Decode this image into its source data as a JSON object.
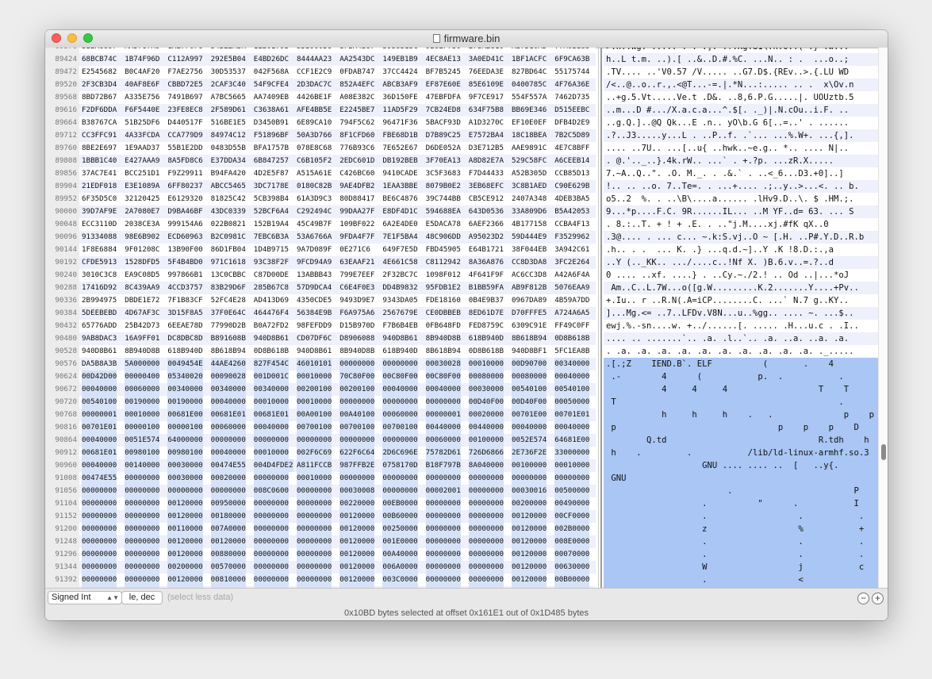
{
  "window": {
    "title": "firmware.bin"
  },
  "hex_rows": [
    {
      "offset": "89376",
      "groups": [
        "3EBA6897",
        "AA5767A9",
        "1AE7F0F6",
        "54BE2A3A",
        "1EB0179B",
        "5DB900D6",
        "3FBA4B67",
        "5938315C",
        "9E6EF730",
        "E73A2810",
        "AE7D10AD",
        "77A0BE83"
      ]
    },
    {
      "offset": "89424",
      "groups": [
        "68BCB74C",
        "1B74F96D",
        "C112A997",
        "292E5B04",
        "E4BD26DC",
        "8444AA23",
        "AA2543DC",
        "149EB1B9",
        "4EC8AE13",
        "3A0ED41C",
        "1BF1ACFC",
        "6F9CA63B"
      ]
    },
    {
      "offset": "89472",
      "groups": [
        "E2545682",
        "B0C4AF20",
        "F7AE2756",
        "30D53537",
        "042F568A",
        "CCF1E2C9",
        "0FDAB747",
        "37CC4424",
        "BF7B5245",
        "76EEDA3E",
        "827BD64C",
        "55175744"
      ]
    },
    {
      "offset": "89520",
      "groups": [
        "2F3CB3D4",
        "40AF8E6F",
        "CBBD72E5",
        "2CAF3C40",
        "54F9CFE4",
        "2D3DAC7C",
        "852A4EFC",
        "ABCB3AF9",
        "EF87E60E",
        "85E6109E",
        "0400785C",
        "4F76A36E"
      ]
    },
    {
      "offset": "89568",
      "groups": [
        "8BD72B67",
        "A335E756",
        "7491B697",
        "A7BC5665",
        "AA7409EB",
        "4426BE1F",
        "A08E382C",
        "36D150FE",
        "47EBFDFA",
        "9F7CE917",
        "554F557A",
        "7462D735"
      ]
    },
    {
      "offset": "89616",
      "groups": [
        "F2DF6DDA",
        "F6F5440E",
        "23FE8EC8",
        "2F589D61",
        "C3638A61",
        "AFE4BB5E",
        "E2245BE7",
        "11AD5F29",
        "7CB24ED8",
        "634F75B8",
        "BB69E346",
        "D515EEBC"
      ]
    },
    {
      "offset": "89664",
      "groups": [
        "B38767CA",
        "51B25DF6",
        "D440517F",
        "516BE1E5",
        "D3450B91",
        "6E89CA10",
        "794F5C62",
        "96471F36",
        "5BACF93D",
        "A1D3270C",
        "EF10E0EF",
        "DFB4D2E9"
      ]
    },
    {
      "offset": "89712",
      "groups": [
        "CC3FFC91",
        "4A33FCDA",
        "CCA779D9",
        "84974C12",
        "F51896BF",
        "50A3D766",
        "8F1CFD60",
        "FBE68D1B",
        "D7B89C25",
        "E7572BA4",
        "18C18BEA",
        "7B2C5D89"
      ]
    },
    {
      "offset": "89760",
      "groups": [
        "8BE2E697",
        "1E9AAD37",
        "55B1E2DD",
        "0483D55B",
        "BFA1757B",
        "078E8C68",
        "776B93C6",
        "7E652E67",
        "D6DE052A",
        "D3E712B5",
        "AAE9891C",
        "4E7C8BFF"
      ]
    },
    {
      "offset": "89808",
      "groups": [
        "1BBB1C40",
        "E427AAA9",
        "8A5FD8C6",
        "E37DDA34",
        "6B847257",
        "C6B105F2",
        "2EDC601D",
        "DB192BEB",
        "3F70EA13",
        "A8D82E7A",
        "529C58FC",
        "A6CEEB14"
      ]
    },
    {
      "offset": "89856",
      "groups": [
        "37AC7E41",
        "BCC251D1",
        "F9Z29911",
        "B94FA420",
        "4D2E5F87",
        "A515A61E",
        "C426BC60",
        "9410CADE",
        "3C5F3683",
        "F7D44433",
        "A52B305D",
        "CCB85D13"
      ]
    },
    {
      "offset": "89904",
      "groups": [
        "21EDF018",
        "E3E1089A",
        "6FF80237",
        "ABCC5465",
        "3DC7178E",
        "0180C82B",
        "9AE4DFB2",
        "1EAA3BBE",
        "8079B0E2",
        "3EB68EFC",
        "3C8B1AED",
        "C90E629B"
      ]
    },
    {
      "offset": "89952",
      "groups": [
        "6F35D5C0",
        "32120425",
        "E6129320",
        "81825C42",
        "5CB398B4",
        "61A3D9C3",
        "80D88417",
        "BE6C4876",
        "39C744BB",
        "CB5CE912",
        "2407A348",
        "4DEB3BA5"
      ]
    },
    {
      "offset": "90000",
      "groups": [
        "39D7AF9E",
        "2A7080E7",
        "D9BA46BF",
        "43DC0339",
        "52BCF6A4",
        "C292494C",
        "99DAA27F",
        "E8DF4D1C",
        "594688EA",
        "643D0536",
        "33A809D6",
        "B5A42053"
      ]
    },
    {
      "offset": "90048",
      "groups": [
        "ECC3110D",
        "2038CE3A",
        "999154A6",
        "022B0821",
        "152B19A4",
        "45C49B7F",
        "109BF022",
        "6A2E4DE0",
        "E5DACA78",
        "6AEF2366",
        "4B177158",
        "CCBA4F13"
      ]
    },
    {
      "offset": "90096",
      "groups": [
        "91334088",
        "98E6B902",
        "ECD60963",
        "B2C0981C",
        "7EBC6B3A",
        "53A6766A",
        "9FDA4F7F",
        "7E1F5BA4",
        "48C906DD",
        "A95023D2",
        "59D444E9",
        "F3529962"
      ]
    },
    {
      "offset": "90144",
      "groups": [
        "1F8E6884",
        "9F01208C",
        "13B90F00",
        "86D1FB04",
        "1D4B9715",
        "9A7D089F",
        "0E271C6",
        "649F7E5D",
        "FBD45905",
        "E64B1721",
        "38F044EB",
        "3A942C61"
      ]
    },
    {
      "offset": "90192",
      "groups": [
        "CFDE5913",
        "1528DFD5",
        "5F4B4BD0",
        "971C1618",
        "93C38F2F",
        "9FCD94A9",
        "63EAAF21",
        "4E661C58",
        "C8112942",
        "8A36A876",
        "CC8D3DA8",
        "3FC2E264"
      ]
    },
    {
      "offset": "90240",
      "groups": [
        "3010C3C8",
        "EA9C08D5",
        "997866B1",
        "13C0CBBC",
        "C87D00DE",
        "13ABBB43",
        "799E7EEF",
        "2F32BC7C",
        "1098F012",
        "4F641F9F",
        "AC6CC3D8",
        "A42A6F4A"
      ]
    },
    {
      "offset": "90288",
      "groups": [
        "17416D92",
        "8C439AA9",
        "4CCD3757",
        "83B29D6F",
        "285B67C8",
        "57D9DCA4",
        "C6E4F0E3",
        "DD4B9832",
        "95FDB1E2",
        "B1BB59FA",
        "AB9F812B",
        "5076EAA9"
      ]
    },
    {
      "offset": "90336",
      "groups": [
        "2B994975",
        "DBDE1E72",
        "7F1B83CF",
        "52FC4E28",
        "AD413D69",
        "4350CDE5",
        "9493D9E7",
        "9343DA05",
        "FDE18160",
        "0B4E9B37",
        "0967DA89",
        "4B59A7DD"
      ]
    },
    {
      "offset": "90384",
      "groups": [
        "5DEEBEBD",
        "4D67AF3C",
        "3D15F8A5",
        "37F0E64C",
        "464476F4",
        "56384E9B",
        "F6A975A6",
        "2567679E",
        "CE0DBBEB",
        "8ED61D7E",
        "D70FFFE5",
        "A724A6A5"
      ]
    },
    {
      "offset": "90432",
      "groups": [
        "65776ADD",
        "25B42D73",
        "6EEAE78D",
        "77990D2B",
        "B0A72FD2",
        "98FEFDD9",
        "D15B970D",
        "F7B6B4EB",
        "0FB648FD",
        "FED8759C",
        "6309C91E",
        "FF49C0FF"
      ]
    },
    {
      "offset": "90480",
      "groups": [
        "9AB8DAC3",
        "16A9FF01",
        "DC8DBC8D",
        "B891608B",
        "940D8B61",
        "CD07DF6C",
        "D8906088",
        "940D8B61",
        "8B940D8B",
        "618B940D",
        "8B618B94",
        "0D8B618B"
      ]
    },
    {
      "offset": "90528",
      "groups": [
        "940D8B61",
        "8B940D8B",
        "618B940D",
        "8B618B94",
        "0D8B618B",
        "940D8B61",
        "8B940D8B",
        "618B940D",
        "8B618B94",
        "0D8B618B",
        "940D8BF1",
        "5FC1EA8B"
      ]
    },
    {
      "offset": "90576",
      "groups": [
        "DA5B8A3B",
        "5A000000",
        "0049454E",
        "44AE4260",
        "827F454C",
        "46010101",
        "00000000",
        "00000000",
        "00030028",
        "00010000",
        "00D90700",
        "00340000"
      ]
    },
    {
      "offset": "90624",
      "groups": [
        "00D42D00",
        "00000400",
        "05340020",
        "00090028",
        "001D001C",
        "00010000",
        "70C80F00",
        "00C80F00",
        "00C80F00",
        "00080000",
        "00080000",
        "00040000"
      ]
    },
    {
      "offset": "90672",
      "groups": [
        "00040000",
        "00060000",
        "00340000",
        "00340000",
        "00340000",
        "00200100",
        "00200100",
        "00040000",
        "00040000",
        "00030000",
        "00540100",
        "00540100"
      ]
    },
    {
      "offset": "90720",
      "groups": [
        "00540100",
        "00190000",
        "00190000",
        "00040000",
        "00010000",
        "00010000",
        "00000000",
        "00000000",
        "00000000",
        "00D40F00",
        "00D40F00",
        "00050000"
      ]
    },
    {
      "offset": "90768",
      "groups": [
        "00000001",
        "00010000",
        "00681E00",
        "00681E01",
        "00681E01",
        "00A00100",
        "00A40100",
        "00060000",
        "00000001",
        "00020000",
        "00701E00",
        "00701E01"
      ]
    },
    {
      "offset": "90816",
      "groups": [
        "00701E01",
        "00000100",
        "00000100",
        "00060000",
        "00040000",
        "00700100",
        "00700100",
        "00700100",
        "00440000",
        "00440000",
        "00040000",
        "00040000"
      ]
    },
    {
      "offset": "90864",
      "groups": [
        "00040000",
        "0051E574",
        "64000000",
        "00000000",
        "00000000",
        "00000000",
        "00000000",
        "00000000",
        "00060000",
        "00100000",
        "0052E574",
        "64681E00"
      ]
    },
    {
      "offset": "90912",
      "groups": [
        "00681E01",
        "00980100",
        "00980100",
        "00040000",
        "00010000",
        "002F6C69",
        "622F6C64",
        "2D6C696E",
        "75782D61",
        "726D6866",
        "2E736F2E",
        "33000000"
      ]
    },
    {
      "offset": "90960",
      "groups": [
        "00040000",
        "00140000",
        "00030000",
        "00474E55",
        "004D4FDE2",
        "A811FCCB",
        "987FFB2E",
        "0758170D",
        "B18F797B",
        "8A040000",
        "00100000",
        "00010000"
      ]
    },
    {
      "offset": "91008",
      "groups": [
        "00474E55",
        "00000000",
        "00030000",
        "00020000",
        "00000000",
        "00010000",
        "00000000",
        "00000000",
        "00000000",
        "00000000",
        "00000000",
        "00000000"
      ]
    },
    {
      "offset": "91056",
      "groups": [
        "00000000",
        "00000000",
        "00000000",
        "00000000",
        "008C0600",
        "00000000",
        "00030008",
        "00000000",
        "00002001",
        "00000000",
        "00030016",
        "00500000"
      ]
    },
    {
      "offset": "91104",
      "groups": [
        "00000000",
        "00000000",
        "00120000",
        "00950000",
        "00000000",
        "00000000",
        "00220000",
        "00EB0000",
        "00000000",
        "00000000",
        "00200000",
        "00490000"
      ]
    },
    {
      "offset": "91152",
      "groups": [
        "00000000",
        "00000000",
        "00120000",
        "00180000",
        "00000000",
        "00000000",
        "00120000",
        "00B60000",
        "00000000",
        "00000000",
        "00120000",
        "00CF0000"
      ]
    },
    {
      "offset": "91200",
      "groups": [
        "00000000",
        "00000000",
        "00110000",
        "007A0000",
        "00000000",
        "00000000",
        "00120000",
        "00250000",
        "00000000",
        "00000000",
        "00120000",
        "002B0000"
      ]
    },
    {
      "offset": "91248",
      "groups": [
        "00000000",
        "00000000",
        "00120000",
        "00120000",
        "00000000",
        "00000000",
        "00120000",
        "001E0000",
        "00000000",
        "00000000",
        "00120000",
        "008E0000"
      ]
    },
    {
      "offset": "91296",
      "groups": [
        "00000000",
        "00000000",
        "00120000",
        "00880000",
        "00000000",
        "00000000",
        "00120000",
        "00A40000",
        "00000000",
        "00000000",
        "00120000",
        "00070000"
      ]
    },
    {
      "offset": "91344",
      "groups": [
        "00000000",
        "00000000",
        "00200000",
        "00570000",
        "00000000",
        "00000000",
        "00120000",
        "006A0000",
        "00000000",
        "00000000",
        "00120000",
        "00630000"
      ]
    },
    {
      "offset": "91392",
      "groups": [
        "00000000",
        "00000000",
        "00120000",
        "00810000",
        "00000000",
        "00000000",
        "00120000",
        "003C0000",
        "00000000",
        "00000000",
        "00120000",
        "00B00000"
      ]
    },
    {
      "offset": "91440",
      "groups": [
        "00000000",
        "00000000",
        "00120000",
        "00160100",
        "00000000",
        "00000000",
        "00020000",
        "006F0000",
        "00000000",
        "00000000",
        "00120000",
        "00430000"
      ]
    },
    {
      "offset": "91488",
      "groups": [
        "00000000",
        "00000000",
        "00120000",
        "00750000",
        "00000000",
        "00000000",
        "00120000",
        "00820000",
        "00000000",
        "00000000",
        "00120000",
        "005E0000"
      ]
    }
  ],
  "ascii_rows": [
    ">.h..Wg. ...T.*: . .]. .?.KgY81\\.n.0.:( .} .w...",
    "h..L t.m. ..).[ ..&..D.#.%C. ...N.. : .  ...o..;",
    ".TV.... ..'V0.57 /V..... ..G7.D$.{REv..>.{.LU WD",
    "/<..@..o..r.,.<@T...-=.|.*N...:..... .. .  x\\Ov.n",
    "..+g.5.Vt.....Ve.t .D&. ..8,6.P.G.....|. UOUztb.5",
    "..m...D #.../X.a.c.a...^.$[. ._)|.N.cOu..i.F. ..",
    "..g.Q.]..@Q Qk...E .n.. yO\\b.G 6[..=..' . ......",
    ".?..J3.....y...L . ..P..f. .`... ...%.W+. ...{,].",
    ".... ..7U.. ...[..u{ ..hwk..~e.g.. *.. .... N|..",
    ". @.'.._..}.4k.rW.. ...` . +.?p. ...zR.X.....",
    "7.~A..Q..\". .O. M._. . .&.` . ..<_6...D3.+0]..]",
    "!.. .. ..o. 7..Te=. . ...+.... .;..y..>...<. .. b.",
    "o5..2  %. . ..\\B\\....a...... .lHv9.D..\\. $ .HM.;.",
    "9...*p....F.C. 9R......IL... ..M YF..d= 63. ... S",
    ". 8.:..T. + ! + .E. . ..\"j.M....xj.#fK qX..0",
    ".3@.... . ... c... ~.k:S.vj..O ~ [.H. ..P#.Y.D..R.b",
    ".h.. . .  ... K. .} ...q.d.~]..Y .K !8.D.:.,a",
    "..Y (.._KK.. .../....c..!Nf X. )B.6.v..=.?..d",
    "0 .... ..xf. ....} . ..Cy.~./2.! .. Od ..|...*oJ",
    " Am..C..L.7W...o([g.W.........K.2.......Y....+Pv..",
    "+.Iu.. r ..R.N(.A=iCP........C. ...` N.7 g..KY..",
    "]...Mg.<= ..7..LFDv.V8N...u..%gg.. .... ~. ...$..",
    "ewj.%.-sn....w. +../......[. ..... .H...u.c . .I..",
    ".... .. .......`.. .a. .l..`.. .a. ..a. ..a. .a.",
    ". .a. .a. .a. .a. .a. .a. .a. .a. .a. .a. ._.....",
    ".[.;Z    IEND.B`. ELF          (       .    4",
    " .-        4      (           p.  .           .",
    "           4     4     4                  T    T",
    " T                                            .",
    "           h     h     h    .   .              p    p",
    " p                                p    p    p    D    D",
    "        Q.td                              R.tdh    h",
    " h    .         .           /lib/ld-linux-armhf.so.3",
    "                   GNU .... .... ..  [   ..y{.",
    " GNU",
    "                        .                        P",
    "                   .          \"      .           I",
    "                   .                  .           .",
    "                   z                  %           +",
    "                   .                  .           .",
    "                   .                  .           .",
    "                   W                  j           c",
    "                   .                  <",
    "                   .                  o           C",
    "                   u                  .           ^"
  ],
  "toolbar": {
    "type_select": "Signed Int",
    "endian_button": "le, dec",
    "info_text": "(select less data)",
    "minus_label": "−",
    "plus_label": "+"
  },
  "status_text": "0x10BD bytes selected at offset 0x161E1 out of 0x1D485 bytes"
}
